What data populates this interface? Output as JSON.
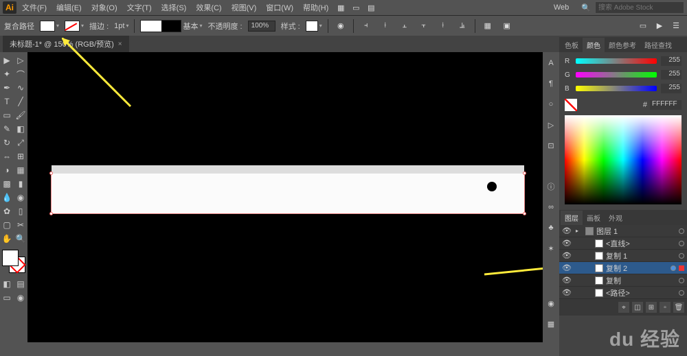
{
  "app_logo": "Ai",
  "menu": {
    "file": "文件(F)",
    "edit": "编辑(E)",
    "object": "对象(O)",
    "text": "文字(T)",
    "select": "选择(S)",
    "effect": "效果(C)",
    "view": "视图(V)",
    "window": "窗口(W)",
    "help": "帮助(H)"
  },
  "workspace": "Web",
  "search_placeholder": "搜索 Adobe Stock",
  "controlbar": {
    "label": "复合路径",
    "stroke_label": "描边 :",
    "stroke_pt": "1pt",
    "basic": "基本",
    "opacity_label": "不透明度 :",
    "opacity_val": "100%",
    "style_label": "样式 :"
  },
  "tab": {
    "name": "未标题-1* @ 150% (RGB/预览)",
    "close": "×"
  },
  "color": {
    "tabs": {
      "swatches": "色板",
      "color": "颜色",
      "guide": "颜色参考",
      "refind": "路径查找"
    },
    "r": "R",
    "g": "G",
    "b": "B",
    "val": "255",
    "hex_label": "#",
    "hex": "FFFFFF"
  },
  "layers": {
    "tabs": {
      "layers": "图层",
      "artboards": "画板",
      "appearance": "外观"
    },
    "items": [
      {
        "name": "图层 1",
        "indent": 0,
        "grp": true,
        "sel": false,
        "target": false
      },
      {
        "name": "<直线>",
        "indent": 1,
        "grp": false,
        "sel": false,
        "target": false
      },
      {
        "name": "复制 1",
        "indent": 1,
        "grp": false,
        "sel": false,
        "target": false
      },
      {
        "name": "复制 2",
        "indent": 1,
        "grp": false,
        "sel": true,
        "target": true
      },
      {
        "name": "复制",
        "indent": 1,
        "grp": false,
        "sel": false,
        "target": false
      },
      {
        "name": "<路径>",
        "indent": 1,
        "grp": false,
        "sel": false,
        "target": false
      }
    ]
  },
  "watermark": "du 经验"
}
